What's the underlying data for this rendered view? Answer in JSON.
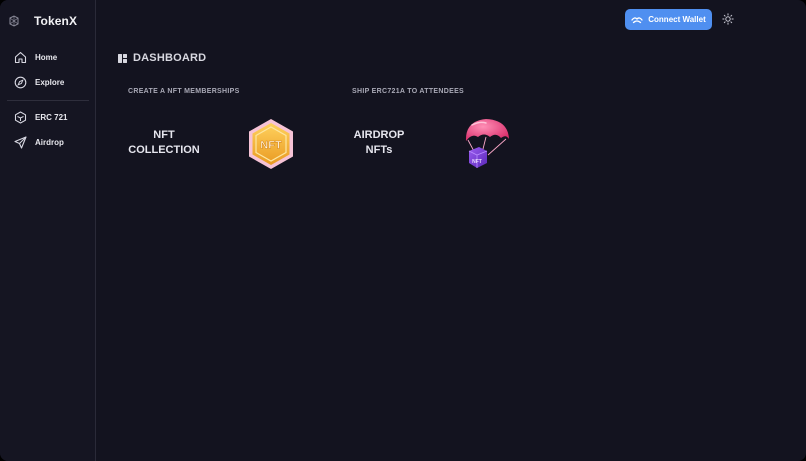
{
  "app": {
    "name": "TokenX"
  },
  "sidebar": {
    "items": [
      {
        "label": "Home",
        "icon": "home-icon"
      },
      {
        "label": "Explore",
        "icon": "compass-icon"
      },
      {
        "label": "ERC 721",
        "icon": "cube-icon"
      },
      {
        "label": "Airdrop",
        "icon": "send-icon"
      }
    ]
  },
  "header": {
    "connect_label": "Connect Wallet",
    "connect_icon": "wallet-icon",
    "theme_icon": "sun-icon"
  },
  "dashboard": {
    "title": "DASHBOARD",
    "sections": [
      {
        "label": "CREATE A NFT MEMBERSHIPS",
        "card_line1": "NFT",
        "card_line2": "COLLECTION",
        "art_icon": "nft-badge-icon",
        "art_text": "NFT"
      },
      {
        "label": "SHIP ERC721A TO ATTENDEES",
        "card_line1": "AIRDROP",
        "card_line2": "NFTs",
        "art_icon": "parachute-icon",
        "art_text": "NFT"
      }
    ]
  },
  "colors": {
    "background": "#13131f",
    "sidebar": "#151522",
    "accent": "#4f8ff0",
    "badge_gold": "#f3b63c",
    "badge_pink": "#f4c0d4",
    "parachute": "#e8467f",
    "box": "#7a3fd8"
  }
}
